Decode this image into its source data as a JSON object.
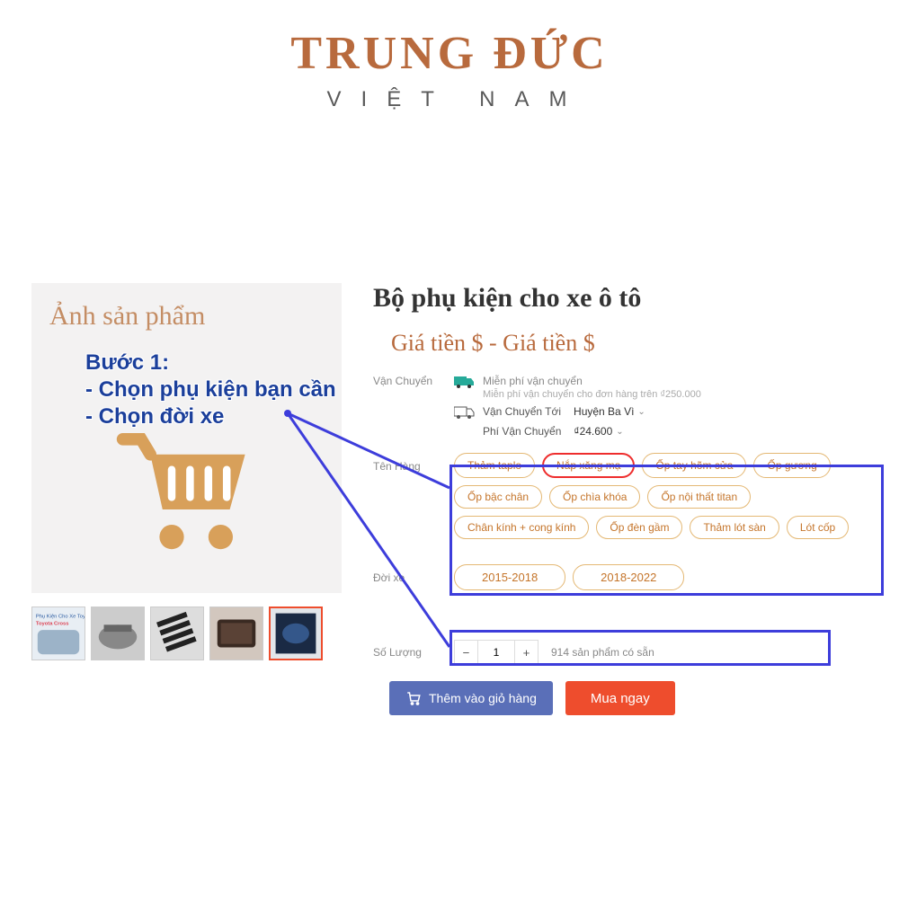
{
  "logo": {
    "main": "TRUNG ĐỨC",
    "sub": "VIỆT NAM"
  },
  "image_placeholder": "Ảnh sản phẩm",
  "annotation": {
    "title": "Bước 1:",
    "line1": "- Chọn phụ kiện bạn cần",
    "line2": "- Chọn đời xe"
  },
  "product": {
    "title": "Bộ phụ kiện cho xe ô tô",
    "price": "Giá tiền $ - Giá tiền $"
  },
  "shipping": {
    "label": "Vận Chuyển",
    "free_title": "Miễn phí vận chuyển",
    "free_sub": "Miễn phí vận chuyển cho đơn hàng trên ₫250.000",
    "to_label": "Vận Chuyển Tới",
    "to_value": "Huyện Ba Vì",
    "fee_label": "Phí Vận Chuyển",
    "fee_value": "₫24.600"
  },
  "options": {
    "variant_label": "Tên Hàng",
    "variants": [
      "Thảm taplo",
      "Nắp xăng mạ",
      "Ốp tay hõm cửa",
      "Ốp gương",
      "Ốp bậc chân",
      "Ốp chìa khóa",
      "Ốp nội thất titan",
      "Chân kính + cong kính",
      "Ốp đèn gầm",
      "Thảm lót sàn",
      "Lót cốp"
    ],
    "year_label": "Đời xe",
    "years": [
      "2015-2018",
      "2018-2022"
    ]
  },
  "qty": {
    "label": "Số Lượng",
    "value": "1",
    "stock": "914 sản phẩm có sẵn"
  },
  "cta": {
    "add_cart": "Thêm vào giỏ hàng",
    "buy_now": "Mua ngay"
  },
  "thumbs": {
    "alt0": "Phụ Kiện Cho Xe Toyota Cross"
  }
}
